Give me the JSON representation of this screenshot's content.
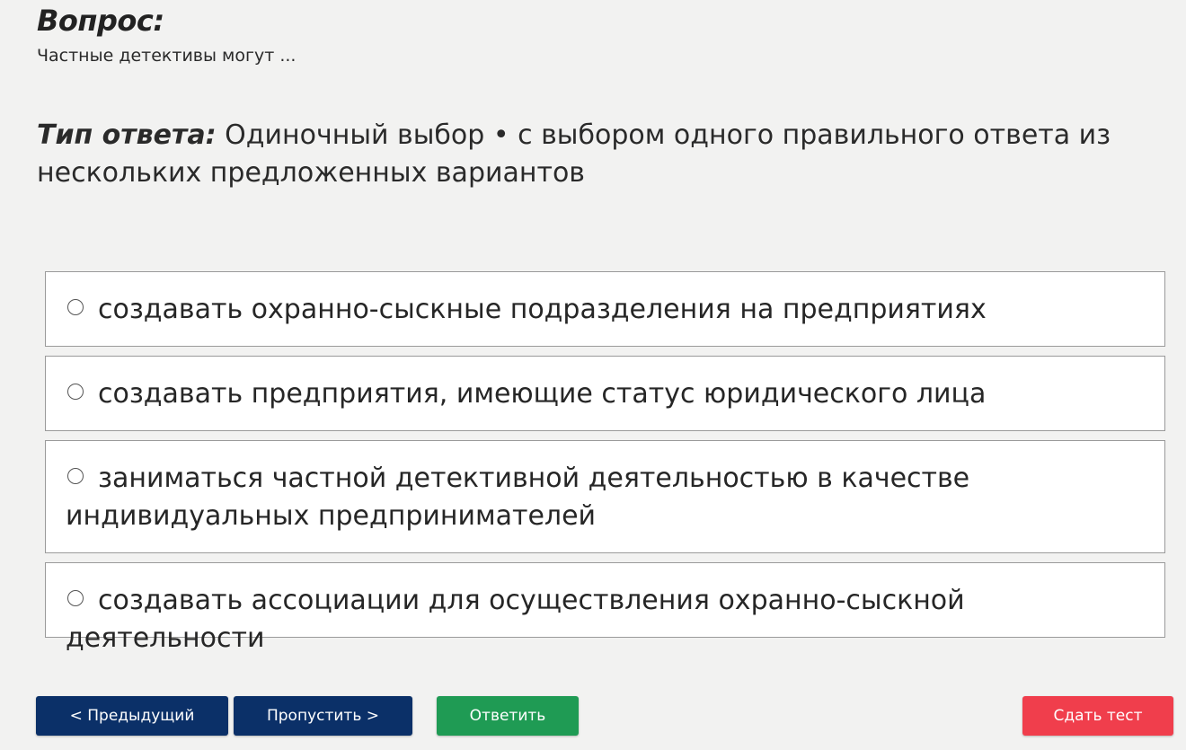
{
  "question": {
    "heading": "Вопрос:",
    "text": "Частные детективы могут ..."
  },
  "answer_type": {
    "label": "Тип ответа:",
    "value": " Одиночный выбор • с выбором одного правильного ответа из нескольких предложенных вариантов"
  },
  "options": [
    {
      "label": "создавать охранно-сыскные подразделения на предприятиях"
    },
    {
      "label": "создавать предприятия, имеющие статус юридического лица"
    },
    {
      "label": "заниматься частной детективной деятельностью в качестве индивидуальных предпринимателей"
    },
    {
      "label": "создавать ассоциации для осуществления охранно-сыскной деятельности"
    }
  ],
  "buttons": {
    "prev": "< Предыдущий",
    "skip": "Пропустить >",
    "answer": "Ответить",
    "submit": "Сдать тест"
  },
  "colors": {
    "nav_button": "#0b3068",
    "answer_button": "#1f9b54",
    "submit_button": "#f03e4c",
    "background": "#f2f2f1"
  }
}
